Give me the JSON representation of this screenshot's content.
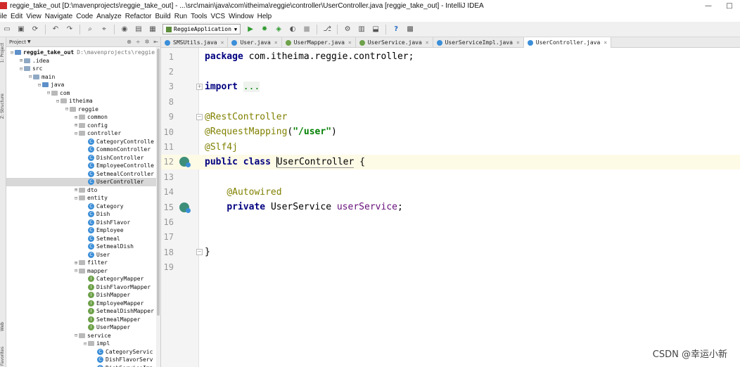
{
  "window": {
    "title": "reggie_take_out [D:\\mavenprojects\\reggie_take_out] - ...\\src\\main\\java\\com\\itheima\\reggie\\controller\\UserController.java [reggie_take_out] - IntelliJ IDEA",
    "controls": {
      "minimize": "—",
      "maximize": "□"
    }
  },
  "menu": [
    "ile",
    "Edit",
    "View",
    "Navigate",
    "Code",
    "Analyze",
    "Refactor",
    "Build",
    "Run",
    "Tools",
    "VCS",
    "Window",
    "Help"
  ],
  "toolbar": {
    "run_config": "ReggieApplication"
  },
  "strip": {
    "project_label": "1: Project",
    "structure_label": "Z: Structure",
    "web_label": "Web",
    "favorites_label": "Favorites"
  },
  "project_panel": {
    "title": "Project",
    "tree": [
      {
        "label": "reggie_take_out",
        "path": "D:\\mavenprojects\\reggie",
        "depth": 0,
        "kind": "folder-blue",
        "toggle": "⊟",
        "bold": true
      },
      {
        "label": ".idea",
        "depth": 1,
        "kind": "folder",
        "toggle": "⊞"
      },
      {
        "label": "src",
        "depth": 1,
        "kind": "folder",
        "toggle": "⊟"
      },
      {
        "label": "main",
        "depth": 2,
        "kind": "folder",
        "toggle": "⊟"
      },
      {
        "label": "java",
        "depth": 3,
        "kind": "folder-blue",
        "toggle": "⊟"
      },
      {
        "label": "com",
        "depth": 4,
        "kind": "package",
        "toggle": "⊟"
      },
      {
        "label": "itheima",
        "depth": 5,
        "kind": "package",
        "toggle": "⊟"
      },
      {
        "label": "reggie",
        "depth": 6,
        "kind": "package",
        "toggle": "⊟"
      },
      {
        "label": "common",
        "depth": 7,
        "kind": "package",
        "toggle": "⊞"
      },
      {
        "label": "config",
        "depth": 7,
        "kind": "package",
        "toggle": "⊞"
      },
      {
        "label": "controller",
        "depth": 7,
        "kind": "package",
        "toggle": "⊟"
      },
      {
        "label": "CategoryControlle",
        "depth": 8,
        "kind": "class"
      },
      {
        "label": "CommonController",
        "depth": 8,
        "kind": "class"
      },
      {
        "label": "DishController",
        "depth": 8,
        "kind": "class"
      },
      {
        "label": "EmployeeControlle",
        "depth": 8,
        "kind": "class"
      },
      {
        "label": "SetmealController",
        "depth": 8,
        "kind": "class"
      },
      {
        "label": "UserController",
        "depth": 8,
        "kind": "class",
        "selected": true
      },
      {
        "label": "dto",
        "depth": 7,
        "kind": "package",
        "toggle": "⊞"
      },
      {
        "label": "entity",
        "depth": 7,
        "kind": "package",
        "toggle": "⊟"
      },
      {
        "label": "Category",
        "depth": 8,
        "kind": "class"
      },
      {
        "label": "Dish",
        "depth": 8,
        "kind": "class"
      },
      {
        "label": "DishFlavor",
        "depth": 8,
        "kind": "class"
      },
      {
        "label": "Employee",
        "depth": 8,
        "kind": "class"
      },
      {
        "label": "Setmeal",
        "depth": 8,
        "kind": "class"
      },
      {
        "label": "SetmealDish",
        "depth": 8,
        "kind": "class"
      },
      {
        "label": "User",
        "depth": 8,
        "kind": "class"
      },
      {
        "label": "filter",
        "depth": 7,
        "kind": "package",
        "toggle": "⊞"
      },
      {
        "label": "mapper",
        "depth": 7,
        "kind": "package",
        "toggle": "⊟"
      },
      {
        "label": "CategoryMapper",
        "depth": 8,
        "kind": "interface"
      },
      {
        "label": "DishFlavorMapper",
        "depth": 8,
        "kind": "interface"
      },
      {
        "label": "DishMapper",
        "depth": 8,
        "kind": "interface"
      },
      {
        "label": "EmployeeMapper",
        "depth": 8,
        "kind": "interface"
      },
      {
        "label": "SetmealDishMapper",
        "depth": 8,
        "kind": "interface"
      },
      {
        "label": "SetmealMapper",
        "depth": 8,
        "kind": "interface"
      },
      {
        "label": "UserMapper",
        "depth": 8,
        "kind": "interface"
      },
      {
        "label": "service",
        "depth": 7,
        "kind": "package",
        "toggle": "⊟"
      },
      {
        "label": "impl",
        "depth": 8,
        "kind": "package",
        "toggle": "⊟"
      },
      {
        "label": "CategoryServic",
        "depth": 9,
        "kind": "class"
      },
      {
        "label": "DishFlavorServ",
        "depth": 9,
        "kind": "class"
      },
      {
        "label": "DishServiceImp",
        "depth": 9,
        "kind": "class"
      }
    ]
  },
  "tabs": [
    {
      "label": "SMSUtils.java",
      "kind": "class"
    },
    {
      "label": "User.java",
      "kind": "class"
    },
    {
      "label": "UserMapper.java",
      "kind": "interface"
    },
    {
      "label": "UserService.java",
      "kind": "interface"
    },
    {
      "label": "UserServiceImpl.java",
      "kind": "class"
    },
    {
      "label": "UserController.java",
      "kind": "class",
      "active": true
    }
  ],
  "editor": {
    "lines": [
      {
        "n": "1",
        "parts": [
          [
            "kw",
            "package "
          ],
          [
            "plain",
            "com.itheima.reggie.controller;"
          ]
        ]
      },
      {
        "n": "2",
        "parts": []
      },
      {
        "n": "3",
        "fold": "+",
        "parts": [
          [
            "kw",
            "import "
          ],
          [
            "dots",
            "..."
          ]
        ]
      },
      {
        "n": "8",
        "parts": []
      },
      {
        "n": "9",
        "fold": "−",
        "parts": [
          [
            "ann",
            "@RestController"
          ]
        ]
      },
      {
        "n": "10",
        "parts": [
          [
            "ann",
            "@RequestMapping"
          ],
          [
            "plain",
            "("
          ],
          [
            "str",
            "\"/user\""
          ],
          [
            "plain",
            ")"
          ]
        ]
      },
      {
        "n": "11",
        "parts": [
          [
            "ann",
            "@Slf4j"
          ]
        ]
      },
      {
        "n": "12",
        "icon": true,
        "current": true,
        "parts": [
          [
            "kw",
            "public class "
          ],
          [
            "caret",
            ""
          ],
          [
            "cls",
            "UserController"
          ],
          [
            "plain",
            " {"
          ]
        ]
      },
      {
        "n": "13",
        "parts": []
      },
      {
        "n": "14",
        "parts": [
          [
            "plain",
            "    "
          ],
          [
            "ann",
            "@Autowired"
          ]
        ]
      },
      {
        "n": "15",
        "icon": true,
        "parts": [
          [
            "plain",
            "    "
          ],
          [
            "kw",
            "private "
          ],
          [
            "plain",
            "UserService "
          ],
          [
            "fld",
            "userService"
          ],
          [
            "plain",
            ";"
          ]
        ]
      },
      {
        "n": "16",
        "parts": []
      },
      {
        "n": "17",
        "parts": []
      },
      {
        "n": "18",
        "fold": "−",
        "parts": [
          [
            "plain",
            "}"
          ]
        ]
      },
      {
        "n": "19",
        "parts": []
      }
    ]
  },
  "watermark": "CSDN @幸运小新"
}
